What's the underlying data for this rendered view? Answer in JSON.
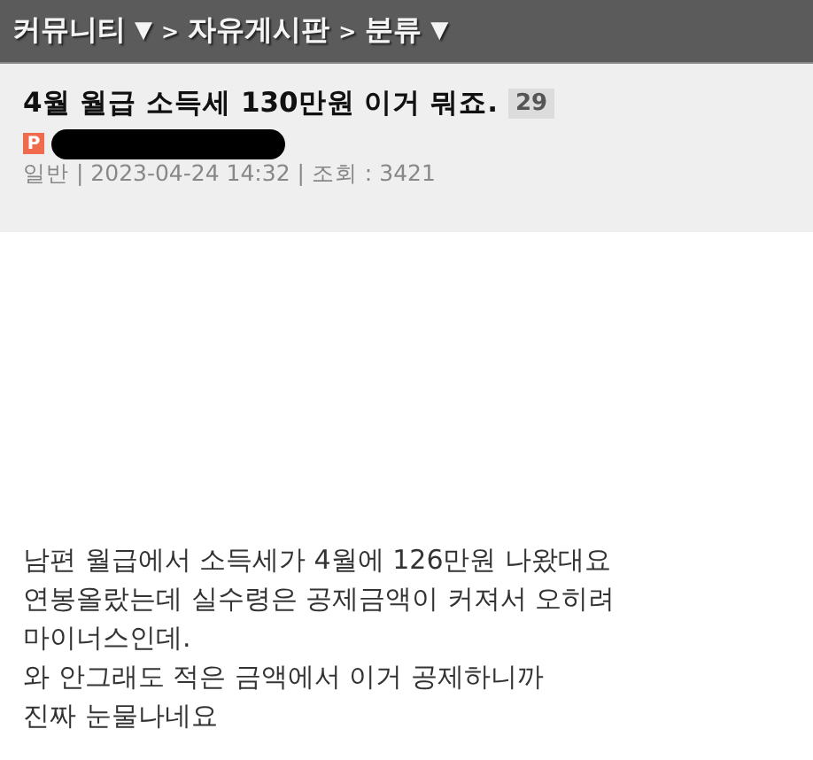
{
  "breadcrumb": [
    {
      "label": "커뮤니티",
      "caret": "▼"
    },
    {
      "separator": ">",
      "label": "자유게시판"
    },
    {
      "separator": ">",
      "label": "분류",
      "caret": "▼"
    }
  ],
  "post": {
    "title": "4월 월급 소득세 130만원 이거 뭐죠.",
    "comment_count": "29",
    "author": {
      "badge": "P",
      "redacted": true
    },
    "meta": "일반 | 2023-04-24 14:32 | 조회 : 3421",
    "body": [
      "남편 월급에서 소득세가 4월에 126만원 나왔대요",
      "연봉올랐는데 실수령은 공제금액이 커져서 오히려",
      "마이너스인데.",
      "와 안그래도 적은 금액에서 이거 공제하니까",
      "진짜 눈물나네요"
    ]
  }
}
